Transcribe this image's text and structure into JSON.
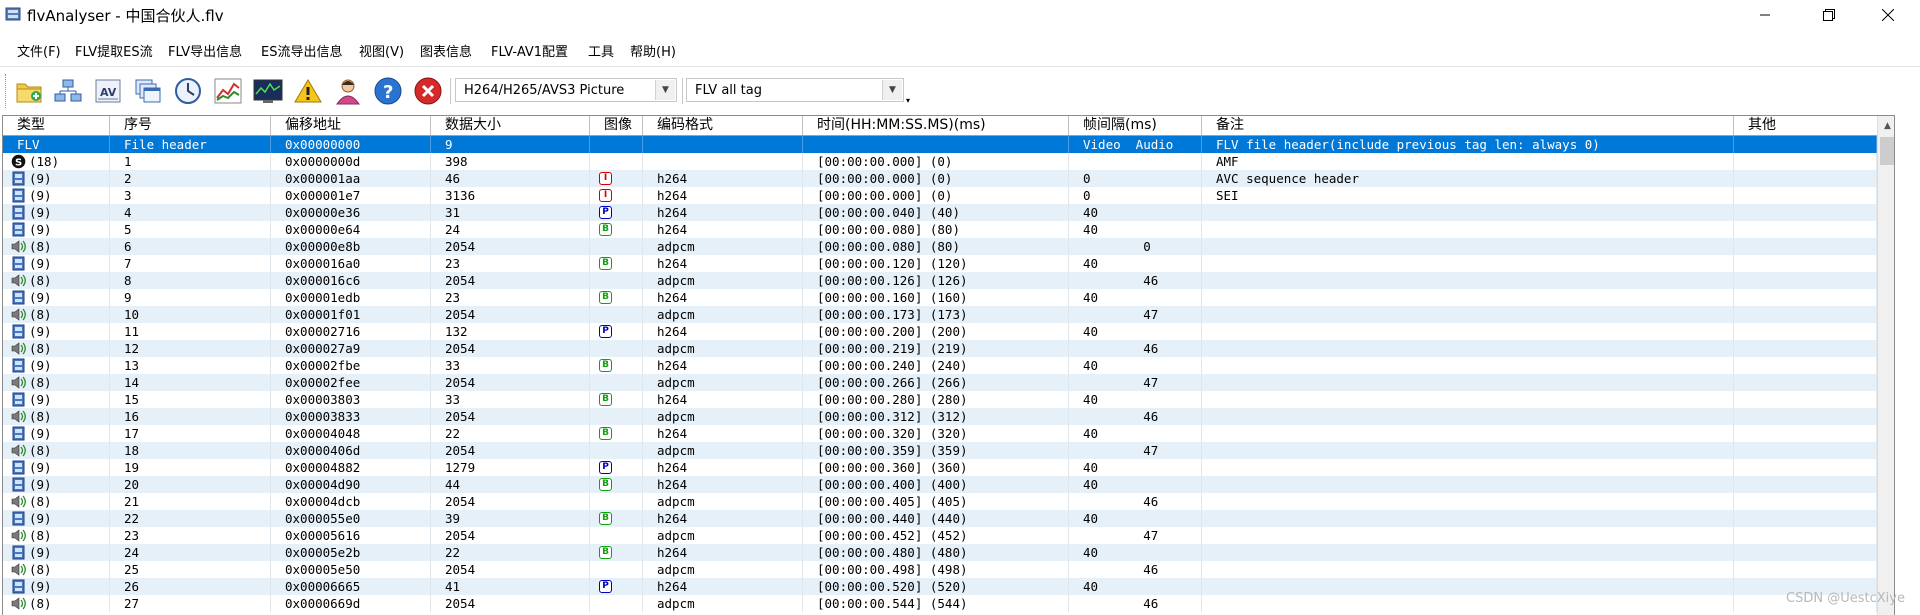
{
  "window": {
    "title": "flvAnalyser - 中国合伙人.flv",
    "minimize": "—",
    "restore": "❐",
    "close": "✕"
  },
  "menu": [
    "文件(F)",
    "FLV提取ES流",
    "FLV导出信息",
    "ES流导出信息",
    "视图(V)",
    "图表信息",
    "FLV-AV1配置",
    "工具",
    "帮助(H)"
  ],
  "toolbar": {
    "icons": [
      "open-folder-icon",
      "network-icon",
      "av-icon",
      "windows-icon",
      "clock-icon",
      "line-chart-icon",
      "monitor-icon",
      "warning-icon",
      "user-icon",
      "help-icon",
      "close-red-icon"
    ],
    "combo1": {
      "value": "H264/H265/AVS3 Picture",
      "arrow": "▼"
    },
    "combo2": {
      "value": "FLV all tag",
      "arrow": "▼"
    }
  },
  "table": {
    "columns": [
      "类型",
      "序号",
      "偏移地址",
      "数据大小",
      "图像",
      "编码格式",
      "时间(HH:MM:SS.MS)(ms)",
      "帧间隔(ms)",
      "备注",
      "其他"
    ],
    "rows": [
      {
        "type_icon": "none",
        "type": "FLV",
        "seq": "File header",
        "offset": "0x00000000",
        "size": "9",
        "frame": "",
        "codec": "",
        "time": "",
        "interval": "Video  Audio",
        "note": "FLV file header(include previous tag len: always 0)",
        "other": "",
        "selected": true
      },
      {
        "type_icon": "script",
        "type": "(18)",
        "seq": "1",
        "offset": "0x0000000d",
        "size": "398",
        "frame": "",
        "codec": "",
        "time": "[00:00:00.000] (0)",
        "interval": "",
        "note": "AMF",
        "other": ""
      },
      {
        "type_icon": "video",
        "type": "(9)",
        "seq": "2",
        "offset": "0x000001aa",
        "size": "46",
        "frame": "I",
        "codec": "h264",
        "time": "[00:00:00.000] (0)",
        "interval": "0",
        "note": "AVC sequence header",
        "other": ""
      },
      {
        "type_icon": "video",
        "type": "(9)",
        "seq": "3",
        "offset": "0x000001e7",
        "size": "3136",
        "frame": "I",
        "codec": "h264",
        "time": "[00:00:00.000] (0)",
        "interval": "0",
        "note": "SEI",
        "other": ""
      },
      {
        "type_icon": "video",
        "type": "(9)",
        "seq": "4",
        "offset": "0x00000e36",
        "size": "31",
        "frame": "P",
        "codec": "h264",
        "time": "[00:00:00.040] (40)",
        "interval": "40",
        "note": "",
        "other": ""
      },
      {
        "type_icon": "video",
        "type": "(9)",
        "seq": "5",
        "offset": "0x00000e64",
        "size": "24",
        "frame": "B",
        "codec": "h264",
        "time": "[00:00:00.080] (80)",
        "interval": "40",
        "note": "",
        "other": ""
      },
      {
        "type_icon": "audio",
        "type": "(8)",
        "seq": "6",
        "offset": "0x00000e8b",
        "size": "2054",
        "frame": "",
        "codec": "adpcm",
        "time": "[00:00:00.080] (80)",
        "interval": "        0",
        "note": "",
        "other": ""
      },
      {
        "type_icon": "video",
        "type": "(9)",
        "seq": "7",
        "offset": "0x000016a0",
        "size": "23",
        "frame": "B",
        "codec": "h264",
        "time": "[00:00:00.120] (120)",
        "interval": "40",
        "note": "",
        "other": ""
      },
      {
        "type_icon": "audio",
        "type": "(8)",
        "seq": "8",
        "offset": "0x000016c6",
        "size": "2054",
        "frame": "",
        "codec": "adpcm",
        "time": "[00:00:00.126] (126)",
        "interval": "        46",
        "note": "",
        "other": ""
      },
      {
        "type_icon": "video",
        "type": "(9)",
        "seq": "9",
        "offset": "0x00001edb",
        "size": "23",
        "frame": "B",
        "codec": "h264",
        "time": "[00:00:00.160] (160)",
        "interval": "40",
        "note": "",
        "other": ""
      },
      {
        "type_icon": "audio",
        "type": "(8)",
        "seq": "10",
        "offset": "0x00001f01",
        "size": "2054",
        "frame": "",
        "codec": "adpcm",
        "time": "[00:00:00.173] (173)",
        "interval": "        47",
        "note": "",
        "other": ""
      },
      {
        "type_icon": "video",
        "type": "(9)",
        "seq": "11",
        "offset": "0x00002716",
        "size": "132",
        "frame": "P",
        "codec": "h264",
        "time": "[00:00:00.200] (200)",
        "interval": "40",
        "note": "",
        "other": ""
      },
      {
        "type_icon": "audio",
        "type": "(8)",
        "seq": "12",
        "offset": "0x000027a9",
        "size": "2054",
        "frame": "",
        "codec": "adpcm",
        "time": "[00:00:00.219] (219)",
        "interval": "        46",
        "note": "",
        "other": ""
      },
      {
        "type_icon": "video",
        "type": "(9)",
        "seq": "13",
        "offset": "0x00002fbe",
        "size": "33",
        "frame": "B",
        "codec": "h264",
        "time": "[00:00:00.240] (240)",
        "interval": "40",
        "note": "",
        "other": ""
      },
      {
        "type_icon": "audio",
        "type": "(8)",
        "seq": "14",
        "offset": "0x00002fee",
        "size": "2054",
        "frame": "",
        "codec": "adpcm",
        "time": "[00:00:00.266] (266)",
        "interval": "        47",
        "note": "",
        "other": ""
      },
      {
        "type_icon": "video",
        "type": "(9)",
        "seq": "15",
        "offset": "0x00003803",
        "size": "33",
        "frame": "B",
        "codec": "h264",
        "time": "[00:00:00.280] (280)",
        "interval": "40",
        "note": "",
        "other": ""
      },
      {
        "type_icon": "audio",
        "type": "(8)",
        "seq": "16",
        "offset": "0x00003833",
        "size": "2054",
        "frame": "",
        "codec": "adpcm",
        "time": "[00:00:00.312] (312)",
        "interval": "        46",
        "note": "",
        "other": ""
      },
      {
        "type_icon": "video",
        "type": "(9)",
        "seq": "17",
        "offset": "0x00004048",
        "size": "22",
        "frame": "B",
        "codec": "h264",
        "time": "[00:00:00.320] (320)",
        "interval": "40",
        "note": "",
        "other": ""
      },
      {
        "type_icon": "audio",
        "type": "(8)",
        "seq": "18",
        "offset": "0x0000406d",
        "size": "2054",
        "frame": "",
        "codec": "adpcm",
        "time": "[00:00:00.359] (359)",
        "interval": "        47",
        "note": "",
        "other": ""
      },
      {
        "type_icon": "video",
        "type": "(9)",
        "seq": "19",
        "offset": "0x00004882",
        "size": "1279",
        "frame": "P",
        "codec": "h264",
        "time": "[00:00:00.360] (360)",
        "interval": "40",
        "note": "",
        "other": ""
      },
      {
        "type_icon": "video",
        "type": "(9)",
        "seq": "20",
        "offset": "0x00004d90",
        "size": "44",
        "frame": "B",
        "codec": "h264",
        "time": "[00:00:00.400] (400)",
        "interval": "40",
        "note": "",
        "other": ""
      },
      {
        "type_icon": "audio",
        "type": "(8)",
        "seq": "21",
        "offset": "0x00004dcb",
        "size": "2054",
        "frame": "",
        "codec": "adpcm",
        "time": "[00:00:00.405] (405)",
        "interval": "        46",
        "note": "",
        "other": ""
      },
      {
        "type_icon": "video",
        "type": "(9)",
        "seq": "22",
        "offset": "0x000055e0",
        "size": "39",
        "frame": "B",
        "codec": "h264",
        "time": "[00:00:00.440] (440)",
        "interval": "40",
        "note": "",
        "other": ""
      },
      {
        "type_icon": "audio",
        "type": "(8)",
        "seq": "23",
        "offset": "0x00005616",
        "size": "2054",
        "frame": "",
        "codec": "adpcm",
        "time": "[00:00:00.452] (452)",
        "interval": "        47",
        "note": "",
        "other": ""
      },
      {
        "type_icon": "video",
        "type": "(9)",
        "seq": "24",
        "offset": "0x00005e2b",
        "size": "22",
        "frame": "B",
        "codec": "h264",
        "time": "[00:00:00.480] (480)",
        "interval": "40",
        "note": "",
        "other": ""
      },
      {
        "type_icon": "audio",
        "type": "(8)",
        "seq": "25",
        "offset": "0x00005e50",
        "size": "2054",
        "frame": "",
        "codec": "adpcm",
        "time": "[00:00:00.498] (498)",
        "interval": "        46",
        "note": "",
        "other": ""
      },
      {
        "type_icon": "video",
        "type": "(9)",
        "seq": "26",
        "offset": "0x00006665",
        "size": "41",
        "frame": "P",
        "codec": "h264",
        "time": "[00:00:00.520] (520)",
        "interval": "40",
        "note": "",
        "other": ""
      },
      {
        "type_icon": "audio",
        "type": "(8)",
        "seq": "27",
        "offset": "0x0000669d",
        "size": "2054",
        "frame": "",
        "codec": "adpcm",
        "time": "[00:00:00.544] (544)",
        "interval": "        46",
        "note": "",
        "other": ""
      }
    ]
  },
  "watermark": "CSDN @UestcXiye",
  "colors": {
    "selection": "#0078d7",
    "alt_row": "#e6f0f8",
    "frame_I": "#d00000",
    "frame_P": "#0000c0",
    "frame_B": "#10a010"
  }
}
